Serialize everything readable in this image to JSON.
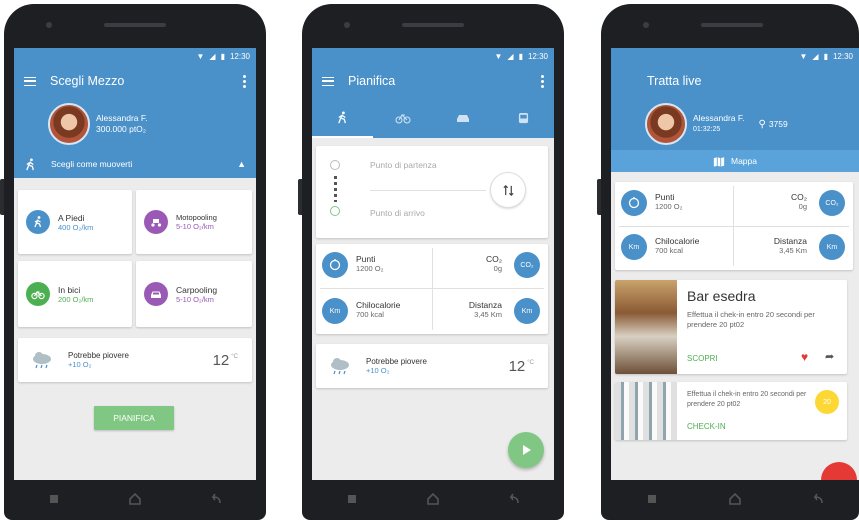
{
  "status": {
    "time": "12:30"
  },
  "phone1": {
    "title": "Scegli Mezzo",
    "user": {
      "name": "Alessandra F.",
      "points": "300.000 ptO₂"
    },
    "choose_label": "Scegli come muoverti",
    "modes": [
      {
        "label": "A Piedi",
        "value": "400 O₂/km",
        "icon": "walking-icon",
        "color": "#4a90c9"
      },
      {
        "label": "Motopooling",
        "value": "5-10 O₂/km",
        "icon": "scooter-icon",
        "color": "#9b59b6"
      },
      {
        "label": "In bici",
        "value": "200 O₂/km",
        "icon": "bicycle-icon",
        "color": "#4caf50"
      },
      {
        "label": "Carpooling",
        "value": "5-10 O₂/km",
        "icon": "car-icon",
        "color": "#9b59b6"
      }
    ],
    "weather": {
      "text": "Potrebbe piovere",
      "bonus": "+10 O₂",
      "temp": "12",
      "unit": "°C"
    },
    "button": "PIANIFICA"
  },
  "phone2": {
    "title": "Pianifica",
    "tabs": [
      "walk-tab",
      "bike-tab",
      "car-tab",
      "bus-tab"
    ],
    "start_placeholder": "Punto di partenza",
    "end_placeholder": "Punto di arrivo",
    "stats": {
      "points_label": "Punti",
      "points_value": "1200 O₂",
      "co2_label": "CO₂",
      "co2_value": "0g",
      "co2_badge": "CO₂",
      "kcal_label": "Chilocalorie",
      "kcal_value": "700 kcal",
      "dist_label": "Distanza",
      "dist_value": "3,45 Km",
      "km_badge": "Km"
    },
    "weather": {
      "text": "Potrebbe piovere",
      "bonus": "+10 O₂",
      "temp": "12",
      "unit": "°C"
    }
  },
  "phone3": {
    "title": "Tratta live",
    "user": {
      "name": "Alessandra F.",
      "timer": "01:32:25",
      "location_count": "3759"
    },
    "map_label": "Mappa",
    "stats": {
      "points_label": "Punti",
      "points_value": "1200 O₂",
      "co2_label": "CO₂",
      "co2_value": "0g",
      "co2_badge": "CO₂",
      "kcal_label": "Chilocalorie",
      "kcal_value": "700 kcal",
      "dist_label": "Distanza",
      "dist_value": "3,45 Km",
      "km_badge": "Km"
    },
    "place": {
      "name": "Bar esedra",
      "desc": "Effettua il chek-in entro 20 secondi per prendere 20 pt02",
      "action": "SCOPRI"
    },
    "offer": {
      "desc": "Effettua il chek-in entro 20 secondi per prendere 20 pt02",
      "badge": "20",
      "action": "CHECK-IN"
    }
  },
  "colors": {
    "primary": "#4a90c9",
    "accent_green": "#81c784",
    "purple": "#9b59b6",
    "yellow": "#fdd835",
    "heart": "#e53935"
  }
}
